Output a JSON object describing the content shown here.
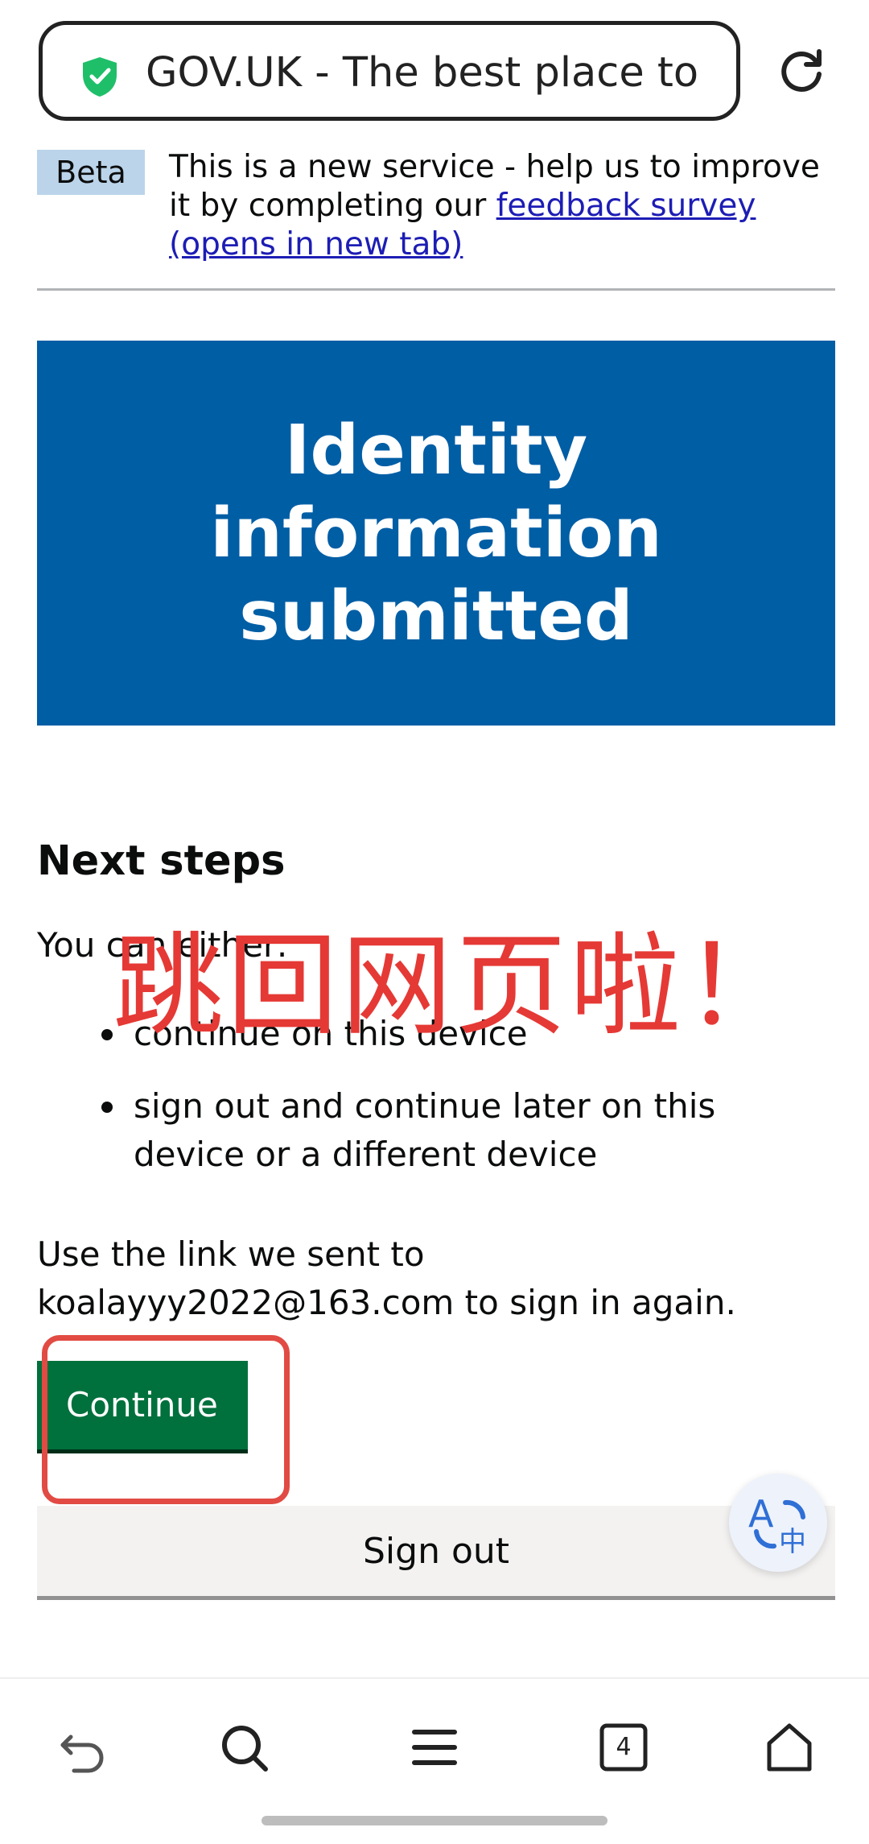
{
  "browser": {
    "url_title": "GOV.UK - The best place to…",
    "tab_count": "4"
  },
  "beta_banner": {
    "tag": "Beta",
    "text_before": "This is a new service - help us to improve it by completing our ",
    "link_text": "feedback survey (opens in new tab)"
  },
  "panel": {
    "title": "Identity information submitted"
  },
  "content": {
    "heading": "Next steps",
    "intro": "You can either:",
    "options": [
      "continue on this device",
      "sign out and continue later on this device or a different device"
    ],
    "signin_note": "Use the link we sent to koalayyy2022@163.com to sign in again."
  },
  "buttons": {
    "continue": "Continue",
    "sign_out": "Sign out"
  },
  "annotation": {
    "overlay_text": "跳回网页啦！",
    "highlight_color": "#e14b43"
  },
  "colors": {
    "panel_bg": "#005ea5",
    "continue_bg": "#00703c",
    "beta_tag_bg": "#bbd4ea",
    "link": "#1d1db5",
    "shield": "#1fbf6a"
  },
  "icons": {
    "secure": "shield-check-icon",
    "reload": "reload-icon",
    "translate": "translate-icon",
    "back": "back-icon",
    "search": "search-icon",
    "menu": "menu-icon",
    "tabs": "tabs-icon",
    "home": "home-icon"
  }
}
